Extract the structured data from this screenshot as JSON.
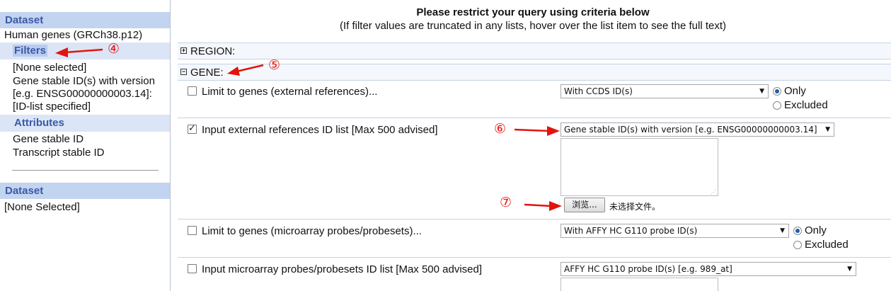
{
  "sidebar": {
    "dataset_header": "Dataset",
    "dataset_name": "Human genes (GRCh38.p12)",
    "filters_label": "Filters",
    "filter_lines": [
      "[None selected]",
      "Gene stable ID(s) with version",
      "[e.g. ENSG00000000003.14]:",
      "[ID-list specified]"
    ],
    "attributes_header": "Attributes",
    "attribute_items": [
      "Gene stable ID",
      "Transcript stable ID"
    ],
    "dataset2_header": "Dataset",
    "dataset2_value": "[None Selected]"
  },
  "main": {
    "title": "Please restrict your query using criteria below",
    "subtitle": "(If filter values are truncated in any lists, hover over the list item to see the full text)",
    "region_label": "REGION:",
    "gene_label": "GENE:",
    "rows": [
      {
        "label": "Limit to genes (external references)...",
        "checked": false,
        "select_value": "With CCDS ID(s)",
        "radio_only": "Only",
        "radio_excluded": "Excluded",
        "selected_radio": "Only"
      },
      {
        "label": "Input external references ID list [Max 500 advised]",
        "checked": true,
        "select_value": "Gene stable ID(s) with version [e.g. ENSG00000000003.14]",
        "browse_button": "浏览...",
        "file_status": "未选择文件。"
      },
      {
        "label": "Limit to genes (microarray probes/probesets)...",
        "checked": false,
        "select_value": "With AFFY HC G110 probe ID(s)",
        "radio_only": "Only",
        "radio_excluded": "Excluded",
        "selected_radio": "Only"
      },
      {
        "label": "Input microarray probes/probesets ID list [Max 500 advised]",
        "checked": false,
        "select_value": "AFFY HC G110 probe ID(s) [e.g. 989_at]"
      }
    ]
  },
  "annotations": {
    "num4": "④",
    "num5": "⑤",
    "num6": "⑥",
    "num7": "⑦",
    "color": "#e3140c"
  },
  "colors": {
    "sidebar_header_bg": "#c3d4f0",
    "sidebar_header_text": "#3a5aa8",
    "section_bg": "#f4f7fc",
    "radio_selected": "#1a5fb4"
  }
}
